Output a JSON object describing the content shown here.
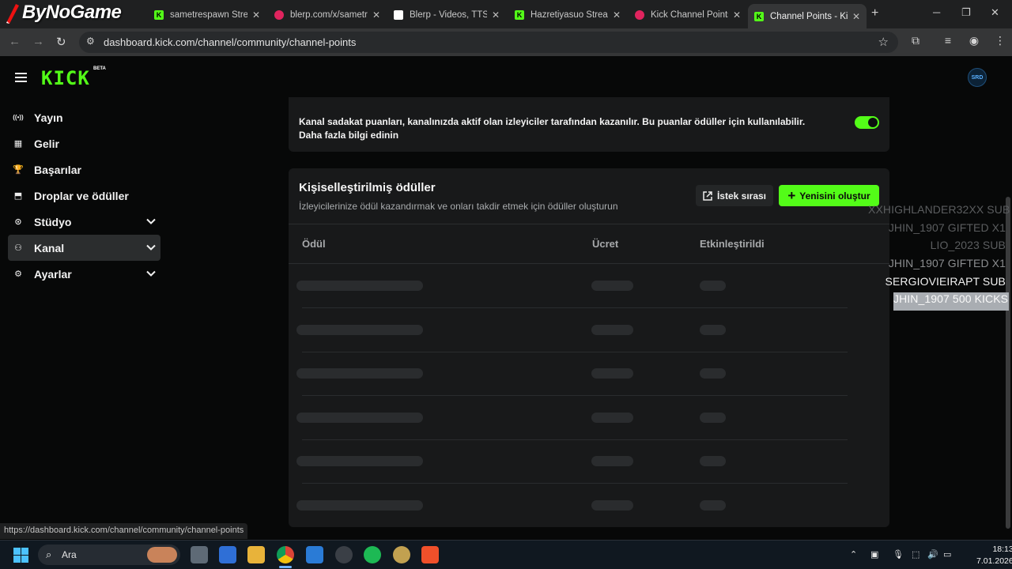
{
  "watermark": "ByNoGame",
  "tabs": [
    {
      "title": "ByNoGame",
      "favicon": "bynogame",
      "kind": "y"
    },
    {
      "title": "sametrespawn Stream",
      "favicon": "kick-icon",
      "kind": "k"
    },
    {
      "title": "blerp.com/x/sametre",
      "favicon": "blerp-icon",
      "kind": "b"
    },
    {
      "title": "Blerp - Videos, TTS, M",
      "favicon": "blerp-logo-icon",
      "kind": "y"
    },
    {
      "title": "Hazretiyasuo Stream",
      "favicon": "kick-icon",
      "kind": "k"
    },
    {
      "title": "Kick Channel Points |",
      "favicon": "blerp-icon",
      "kind": "b"
    },
    {
      "title": "Channel Points - Kick",
      "favicon": "kick-icon",
      "kind": "k",
      "active": true
    }
  ],
  "address": {
    "url": "dashboard.kick.com/channel/community/channel-points"
  },
  "brand": {
    "logo": "KICK",
    "badge": "BETA",
    "accent": "#53fc18",
    "avatar": "SRD"
  },
  "sidebar": {
    "items": [
      {
        "label": "Yayın",
        "icon": "broadcast-icon",
        "chevron": false,
        "active": false
      },
      {
        "label": "Gelir",
        "icon": "revenue-icon",
        "chevron": false,
        "active": false
      },
      {
        "label": "Başarılar",
        "icon": "trophy-icon",
        "chevron": false,
        "active": false
      },
      {
        "label": "Droplar ve ödüller",
        "icon": "drops-icon",
        "chevron": false,
        "active": false
      },
      {
        "label": "Stüdyo",
        "icon": "studio-icon",
        "chevron": true,
        "active": false
      },
      {
        "label": "Kanal",
        "icon": "channel-icon",
        "chevron": true,
        "active": true
      },
      {
        "label": "Ayarlar",
        "icon": "settings-icon",
        "chevron": true,
        "active": false
      }
    ]
  },
  "loyalty_card": {
    "text_line1": "Kanal sadakat puanları, kanalınızda aktif olan izleyiciler tarafından kazanılır. Bu puanlar ödüller için kullanılabilir.",
    "text_line2": "Daha fazla bilgi edinin",
    "toggle_on": true
  },
  "rewards_card": {
    "title": "Kişiselleştirilmiş ödüller",
    "subtitle": "İzleyicilerinize ödül kazandırmak ve onları takdir etmek için ödüller oluşturun",
    "queue_button": "İstek sırası",
    "new_button": "Yenisini oluştur",
    "columns": [
      "Ödül",
      "Ücret",
      "Etkinleştirildi"
    ],
    "loading_rows": 6
  },
  "overlay_chat": [
    {
      "text": "XXHIGHLANDER32XX  SUB",
      "tone": "dim"
    },
    {
      "text": "JHIN_1907  GIFTED X1",
      "tone": "dim"
    },
    {
      "text": "LIO_2023  SUB",
      "tone": "dim"
    },
    {
      "text": "JHIN_1907  GIFTED X1",
      "tone": "mid"
    },
    {
      "text": "SERGIOVIEIRAPT  SUB",
      "tone": "bright"
    },
    {
      "text": "JHIN_1907  500 KICKS",
      "tone": "hl"
    }
  ],
  "status_url": "https://dashboard.kick.com/channel/community/channel-points",
  "taskbar": {
    "search_label": "Ara",
    "time": "18:13",
    "date": "7.01.2026"
  }
}
